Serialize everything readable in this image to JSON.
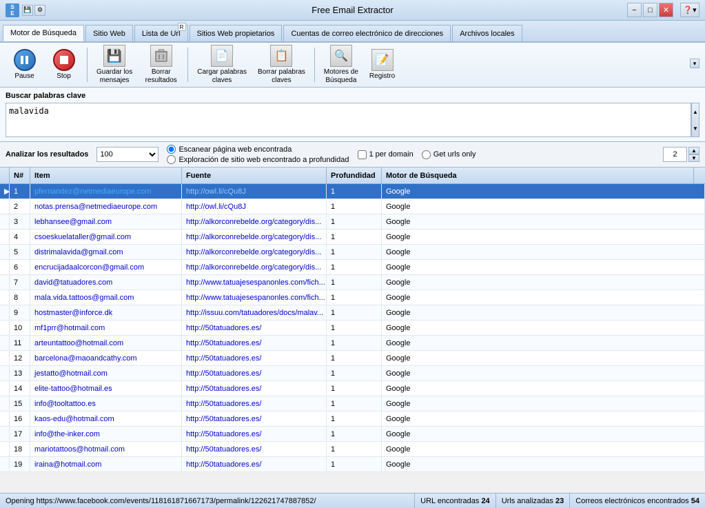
{
  "titleBar": {
    "title": "Free Email Extractor",
    "minBtn": "−",
    "maxBtn": "□",
    "closeBtn": "✕"
  },
  "tabs": [
    {
      "id": "motor",
      "label": "Motor de Búsqueda",
      "active": true
    },
    {
      "id": "sitioweb",
      "label": "Sitio Web",
      "active": false
    },
    {
      "id": "lista",
      "label": "Lista de Url",
      "active": false,
      "badge": "R"
    },
    {
      "id": "propietarios",
      "label": "Sitios Web propietarios",
      "active": false
    },
    {
      "id": "cuentas",
      "label": "Cuentas de correo electrónico de direcciones",
      "active": false
    },
    {
      "id": "archivos",
      "label": "Archivos locales",
      "active": false
    }
  ],
  "toolbar": {
    "pauseLabel": "Pause",
    "stopLabel": "Stop",
    "saveLabel": "Guardar los\nmensajes",
    "deleteLabel": "Borrar\nresultados",
    "loadKeywordsLabel": "Cargar palabras\nclaves",
    "deleteKeywordsLabel": "Borrar palabras\nclaves",
    "searchEnginesLabel": "Motores de\nBúsqueda",
    "logLabel": "Registro"
  },
  "search": {
    "sectionLabel": "Buscar palabras clave",
    "value": "malavida"
  },
  "options": {
    "label": "Analizar los resultados",
    "selectValue": "100",
    "radioOption1": "Escanear página web encontrada",
    "radioOption2": "Exploración de sitio web encontrado a profundidad",
    "checkboxLabel": "1 per domain",
    "radioGetUrls": "Get urls only",
    "spinValue": "2"
  },
  "tableHeaders": {
    "arrow": "",
    "n": "N#",
    "item": "Item",
    "fuente": "Fuente",
    "profundidad": "Profundidad",
    "motorBusqueda": "Motor de Búsqueda"
  },
  "tableRows": [
    {
      "n": 1,
      "item": "pfernandez@netmediaeurope.com",
      "fuente": "http://owl.li/cQu8J",
      "profundidad": 1,
      "motor": "Google",
      "selected": true
    },
    {
      "n": 2,
      "item": "notas.prensa@netmediaeurope.com",
      "fuente": "http://owl.li/cQu8J",
      "profundidad": 1,
      "motor": "Google",
      "selected": false
    },
    {
      "n": 3,
      "item": "lebhansee@gmail.com",
      "fuente": "http://alkorconrebelde.org/category/dis...",
      "profundidad": 1,
      "motor": "Google",
      "selected": false
    },
    {
      "n": 4,
      "item": "csoeskuelataller@gmail.com",
      "fuente": "http://alkorconrebelde.org/category/dis...",
      "profundidad": 1,
      "motor": "Google",
      "selected": false
    },
    {
      "n": 5,
      "item": "distrimalavida@gmail.com",
      "fuente": "http://alkorconrebelde.org/category/dis...",
      "profundidad": 1,
      "motor": "Google",
      "selected": false
    },
    {
      "n": 6,
      "item": "encrucijadaalcorcon@gmail.com",
      "fuente": "http://alkorconrebelde.org/category/dis...",
      "profundidad": 1,
      "motor": "Google",
      "selected": false
    },
    {
      "n": 7,
      "item": "david@tatuadores.com",
      "fuente": "http://www.tatuajesespanonles.com/fich...",
      "profundidad": 1,
      "motor": "Google",
      "selected": false
    },
    {
      "n": 8,
      "item": "mala.vida.tattoos@gmail.com",
      "fuente": "http://www.tatuajesespanonles.com/fich...",
      "profundidad": 1,
      "motor": "Google",
      "selected": false
    },
    {
      "n": 9,
      "item": "hostmaster@inforce.dk",
      "fuente": "http://issuu.com/tatuadores/docs/malav...",
      "profundidad": 1,
      "motor": "Google",
      "selected": false
    },
    {
      "n": 10,
      "item": "mf1prr@hotmail.com",
      "fuente": "http://50tatuadores.es/",
      "profundidad": 1,
      "motor": "Google",
      "selected": false
    },
    {
      "n": 11,
      "item": "arteuntattoo@hotmail.com",
      "fuente": "http://50tatuadores.es/",
      "profundidad": 1,
      "motor": "Google",
      "selected": false
    },
    {
      "n": 12,
      "item": "barcelona@maoandcathy.com",
      "fuente": "http://50tatuadores.es/",
      "profundidad": 1,
      "motor": "Google",
      "selected": false
    },
    {
      "n": 13,
      "item": "jestatto@hotmail.com",
      "fuente": "http://50tatuadores.es/",
      "profundidad": 1,
      "motor": "Google",
      "selected": false
    },
    {
      "n": 14,
      "item": "elite-tattoo@hotmail.es",
      "fuente": "http://50tatuadores.es/",
      "profundidad": 1,
      "motor": "Google",
      "selected": false
    },
    {
      "n": 15,
      "item": "info@tooltattoo.es",
      "fuente": "http://50tatuadores.es/",
      "profundidad": 1,
      "motor": "Google",
      "selected": false
    },
    {
      "n": 16,
      "item": "kaos-edu@hotmail.com",
      "fuente": "http://50tatuadores.es/",
      "profundidad": 1,
      "motor": "Google",
      "selected": false
    },
    {
      "n": 17,
      "item": "info@the-inker.com",
      "fuente": "http://50tatuadores.es/",
      "profundidad": 1,
      "motor": "Google",
      "selected": false
    },
    {
      "n": 18,
      "item": "mariotattoos@hotmail.com",
      "fuente": "http://50tatuadores.es/",
      "profundidad": 1,
      "motor": "Google",
      "selected": false
    },
    {
      "n": 19,
      "item": "iraina@hotmail.com",
      "fuente": "http://50tatuadores.es/",
      "profundidad": 1,
      "motor": "Google",
      "selected": false
    }
  ],
  "statusBar": {
    "openingUrl": "Opening https://www.facebook.com/events/118161871667173/permalink/122621747887852/",
    "urlsEncontradas": "URL encontradas",
    "urlsEncontradasCount": "24",
    "urlsAnalizadas": "Urls analizadas",
    "urlsAnalizadasCount": "23",
    "correosEncontrados": "Correos electrónicos encontrados",
    "correosEncontradosCount": "54"
  }
}
